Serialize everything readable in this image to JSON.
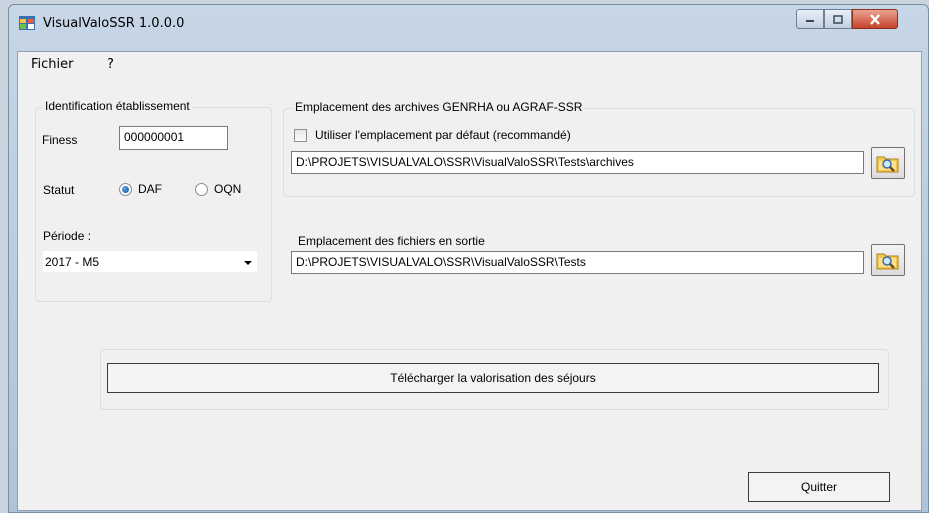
{
  "window": {
    "title": "VisualValoSSR 1.0.0.0"
  },
  "menu": {
    "items": [
      "Fichier",
      "?"
    ]
  },
  "identification": {
    "group_label": "Identification établissement",
    "finess_label": "Finess",
    "finess_value": "000000001",
    "statut_label": "Statut",
    "radio_daf_label": "DAF",
    "radio_oqn_label": "OQN",
    "selected_statut": "DAF",
    "periode_label": "Période :",
    "periode_value": "2017 - M5"
  },
  "archives": {
    "group_label": "Emplacement des archives GENRHA ou AGRAF-SSR",
    "checkbox_label": "Utiliser l'emplacement par défaut (recommandé)",
    "checkbox_checked": false,
    "path_value": "D:\\PROJETS\\VISUALVALO\\SSR\\VisualValoSSR\\Tests\\archives"
  },
  "output": {
    "label": "Emplacement des fichiers en sortie",
    "path_value": "D:\\PROJETS\\VISUALVALO\\SSR\\VisualValoSSR\\Tests"
  },
  "actions": {
    "download_label": "Télécharger la valorisation des séjours",
    "quit_label": "Quitter"
  },
  "icons": {
    "app": "app-window-icon",
    "browse": "folder-search-icon",
    "dropdown": "chevron-down-icon"
  }
}
